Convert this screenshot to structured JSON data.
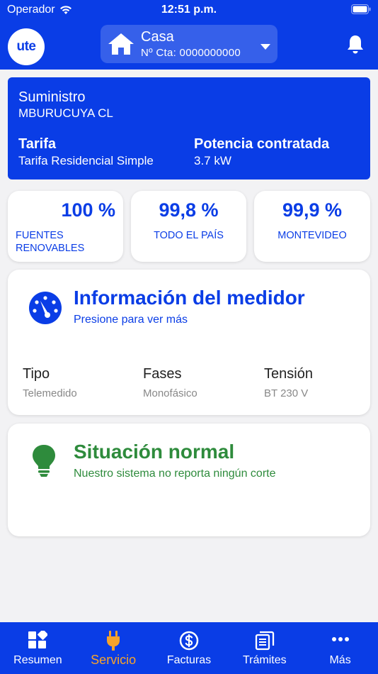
{
  "status_bar": {
    "carrier": "Operador",
    "time": "12:51 p.m."
  },
  "header": {
    "logo_text": "ute",
    "account_name": "Casa",
    "account_number": "Nº Cta: 0000000000",
    "icons": [
      "house-icon",
      "chevron-down-icon",
      "bell-icon"
    ]
  },
  "supply": {
    "label": "Suministro",
    "name": "MBURUCUYA CL",
    "tariff_label": "Tarifa",
    "tariff_value": "Tarifa Residencial Simple",
    "power_label": "Potencia contratada",
    "power_value": "3.7 kW"
  },
  "stats": [
    {
      "value": "100 %",
      "caption_1": "FUENTES",
      "caption_2": "RENOVABLES"
    },
    {
      "value": "99,8 %",
      "caption_1": "TODO EL PAÍS"
    },
    {
      "value": "99,9 %",
      "caption_1": "MONTEVIDEO"
    }
  ],
  "meter": {
    "title": "Información del medidor",
    "subtitle": "Presione para ver más",
    "columns": [
      {
        "label": "Tipo",
        "value": "Telemedido"
      },
      {
        "label": "Fases",
        "value": "Monofásico"
      },
      {
        "label": "Tensión",
        "value": "BT 230 V"
      }
    ]
  },
  "situation": {
    "title": "Situación normal",
    "subtitle": "Nuestro sistema no reporta ningún corte"
  },
  "tabs": [
    {
      "label": "Resumen",
      "icon": "dashboard-icon"
    },
    {
      "label": "Servicio",
      "icon": "plug-icon",
      "active": true
    },
    {
      "label": "Facturas",
      "icon": "dollar-circle-icon"
    },
    {
      "label": "Trámites",
      "icon": "documents-icon"
    },
    {
      "label": "Más",
      "icon": "more-icon"
    }
  ],
  "colors": {
    "primary": "#0a3de6",
    "active_tab": "#f7a32a",
    "success": "#2e8b3c"
  }
}
